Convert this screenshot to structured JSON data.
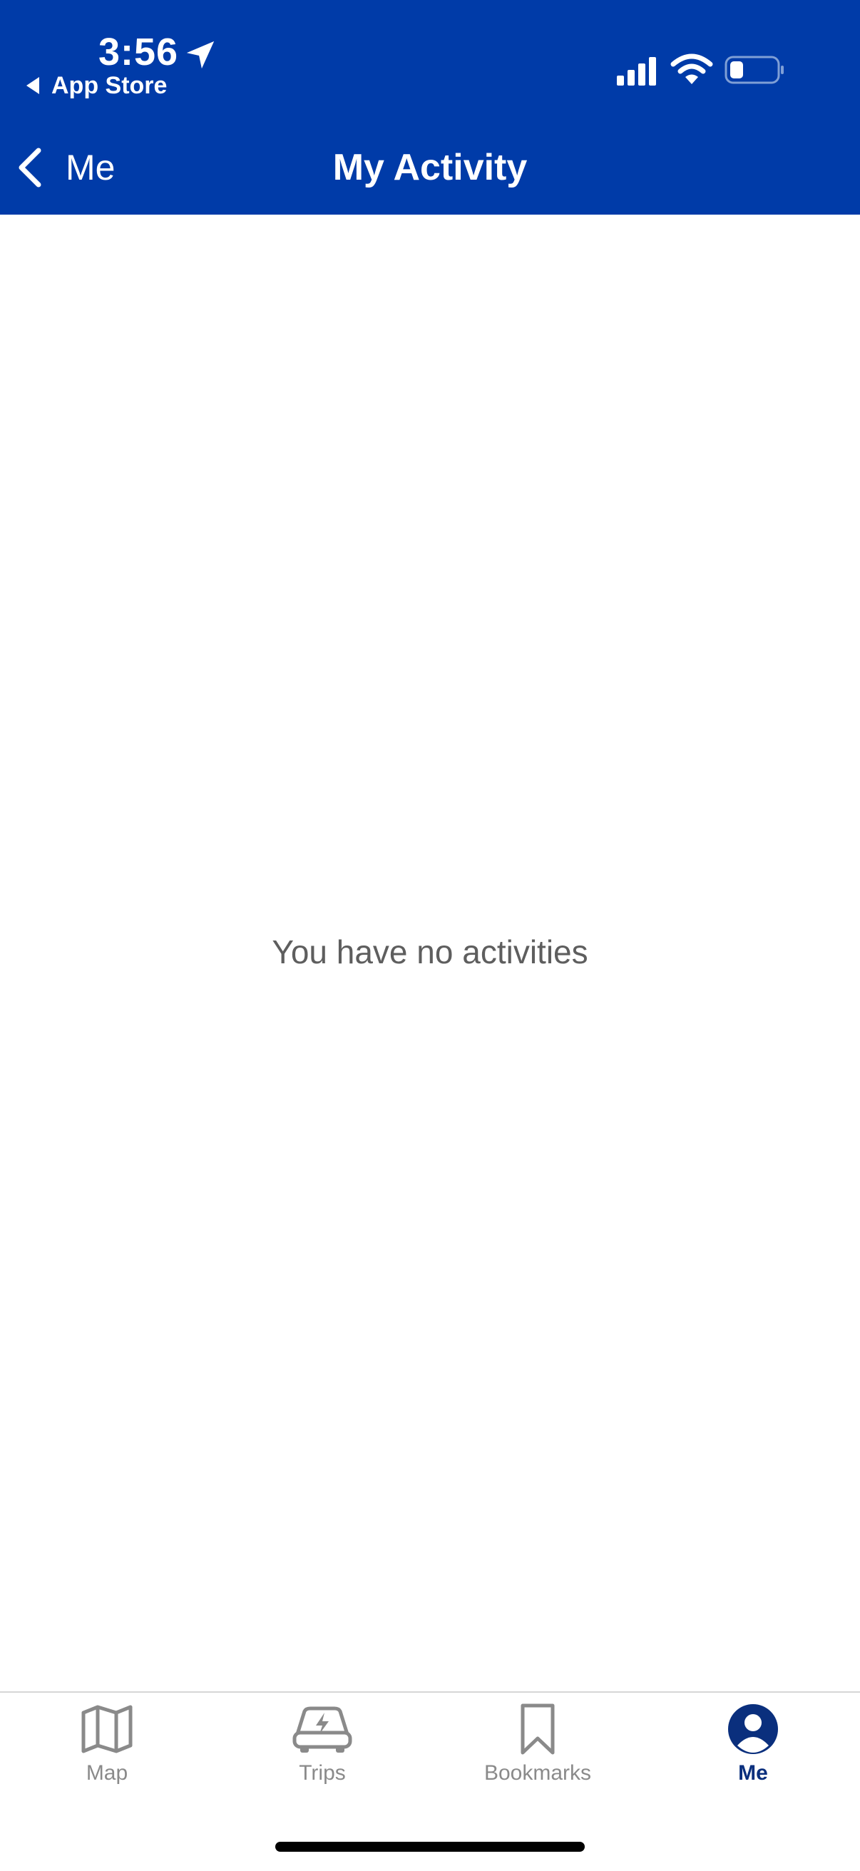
{
  "status_bar": {
    "time": "3:56",
    "back_to_app": "App Store"
  },
  "header": {
    "back_label": "Me",
    "title": "My Activity"
  },
  "main": {
    "empty_message": "You have no activities"
  },
  "tabbar": {
    "tabs": [
      {
        "label": "Map",
        "icon": "map-icon",
        "active": false
      },
      {
        "label": "Trips",
        "icon": "car-bolt-icon",
        "active": false
      },
      {
        "label": "Bookmarks",
        "icon": "bookmark-icon",
        "active": false
      },
      {
        "label": "Me",
        "icon": "person-icon",
        "active": true
      }
    ]
  },
  "colors": {
    "header_bg": "#003ba8",
    "active_tab": "#0a2f7d",
    "inactive_tab": "#8a8a8a"
  }
}
